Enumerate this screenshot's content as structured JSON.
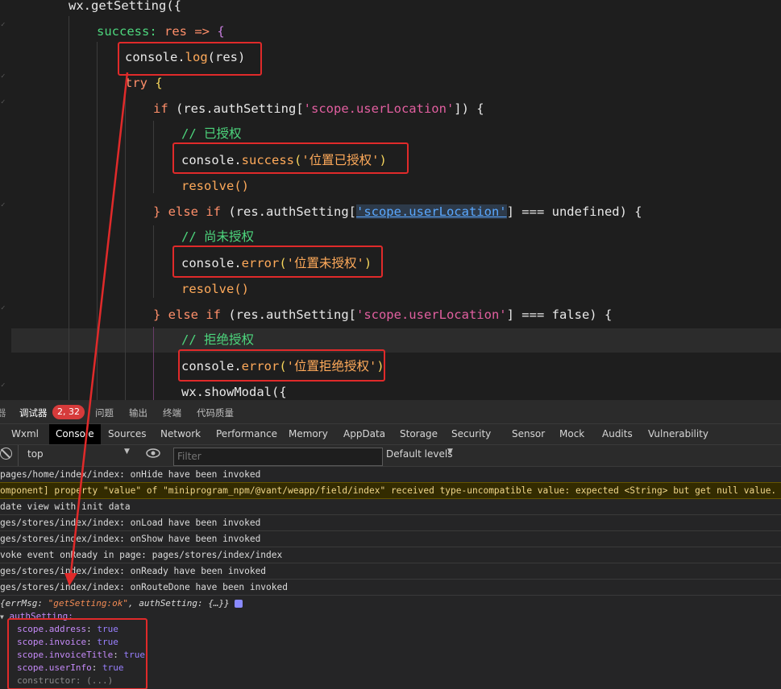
{
  "editor": {
    "lines": {
      "l0": "wx.getSetting({",
      "l1_key": "success:",
      "l1_param": "res",
      "l1_arrow": "=>",
      "l1_brace": "{",
      "l2_obj": "console.",
      "l2_fn": "log",
      "l2_args": "(res)",
      "l3_kw": "try",
      "l3_brace": "{",
      "l4_kw": "if",
      "l4_pre": "(res.authSetting[",
      "l4_str": "'scope.userLocation'",
      "l4_post": "]) {",
      "l5_cmt": "// 已授权",
      "l6_obj": "console.",
      "l6_fn": "success",
      "l6_open": "(",
      "l6_str": "'位置已授权'",
      "l6_close": ")",
      "l7": "resolve()",
      "l8_pre": "} else if",
      "l8_mid": "(res.authSetting[",
      "l8_str": "'scope.userLocation'",
      "l8_post": "] === undefined) {",
      "l9_cmt": "// 尚未授权",
      "l10_obj": "console.",
      "l10_fn": "error",
      "l10_open": "(",
      "l10_str": "'位置未授权'",
      "l10_close": ")",
      "l11": "resolve()",
      "l12_pre": "} else if",
      "l12_mid": "(res.authSetting[",
      "l12_str": "'scope.userLocation'",
      "l12_post": "] === false) {",
      "l13_cmt": "// 拒绝授权",
      "l14_obj": "console.",
      "l14_fn": "error",
      "l14_open": "(",
      "l14_str": "'位置拒绝授权'",
      "l14_close": ")",
      "l15": "wx.showModal({"
    }
  },
  "devtools": {
    "top_tabs": {
      "partial": "器",
      "debugger": "调试器",
      "badge": "2, 32",
      "issues": "问题",
      "output": "输出",
      "terminal": "终端",
      "code_quality": "代码质量"
    },
    "panel_tabs": [
      "Wxml",
      "Console",
      "Sources",
      "Network",
      "Performance",
      "Memory",
      "AppData",
      "Storage",
      "Security",
      "Sensor",
      "Mock",
      "Audits",
      "Vulnerability"
    ],
    "context_select": "top",
    "filter_placeholder": "Filter",
    "levels": "Default levels",
    "messages": [
      "pages/home/index/index: onHide have been invoked",
      "omponent] property \"value\" of \"miniprogram_npm/@vant/weapp/field/index\" received type-uncompatible value: expected <String> but get null value. Use",
      "date view with init data",
      "ges/stores/index/index: onLoad have been invoked",
      "ges/stores/index/index: onShow have been invoked",
      "voke event onReady in page: pages/stores/index/index",
      "ges/stores/index/index: onReady have been invoked",
      "ges/stores/index/index: onRouteDone have been invoked"
    ],
    "object_summary": {
      "prefix": "{errMsg: ",
      "errmsg": "\"getSetting:ok\"",
      "mid": ", authSetting: ",
      "suffix": "{…}}"
    },
    "auth_label": "authSetting:",
    "auth_items": [
      {
        "key": "scope.address",
        "value": "true"
      },
      {
        "key": "scope.invoice",
        "value": "true"
      },
      {
        "key": "scope.invoiceTitle",
        "value": "true"
      },
      {
        "key": "scope.userInfo",
        "value": "true"
      },
      {
        "key": "constructor",
        "value": "(...)"
      }
    ]
  }
}
